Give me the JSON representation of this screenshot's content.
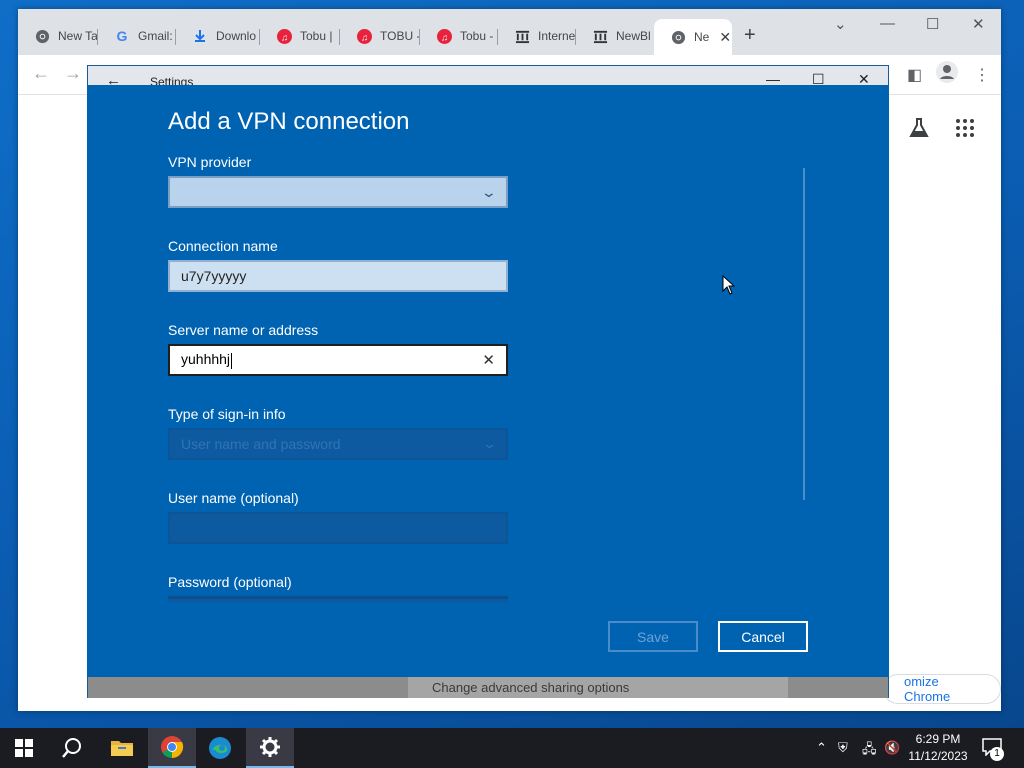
{
  "browser": {
    "tabs": [
      {
        "label": "New Ta",
        "icon": "chrome-icon"
      },
      {
        "label": "Gmail:",
        "icon": "google-icon"
      },
      {
        "label": "Downlo",
        "icon": "download-icon"
      },
      {
        "label": "Tobu |",
        "icon": "music-icon"
      },
      {
        "label": "TOBU -",
        "icon": "music-icon"
      },
      {
        "label": "Tobu -",
        "icon": "music-icon"
      },
      {
        "label": "Interne",
        "icon": "archive-icon"
      },
      {
        "label": "NewBl",
        "icon": "archive-icon"
      },
      {
        "label": "Ne",
        "icon": "chrome-icon",
        "active": true
      }
    ],
    "customize_label": "omize Chrome"
  },
  "settings": {
    "title": "Settings",
    "footer_link": "Change advanced sharing options"
  },
  "dialog": {
    "title": "Add a VPN connection",
    "vpn_provider_label": "VPN provider",
    "vpn_provider_value": "",
    "connection_name_label": "Connection name",
    "connection_name_value": "u7y7yyyyy",
    "server_label": "Server name or address",
    "server_value": "yuhhhhj",
    "signin_label": "Type of sign-in info",
    "signin_value": "User name and password",
    "username_label": "User name (optional)",
    "password_label": "Password (optional)",
    "save_label": "Save",
    "cancel_label": "Cancel"
  },
  "taskbar": {
    "time": "6:29 PM",
    "date": "11/12/2023",
    "notification_count": "1"
  },
  "colors": {
    "dialog_bg": "#0063b1",
    "taskbar_bg": "#1b1b22",
    "accent": "#76b9ed"
  }
}
